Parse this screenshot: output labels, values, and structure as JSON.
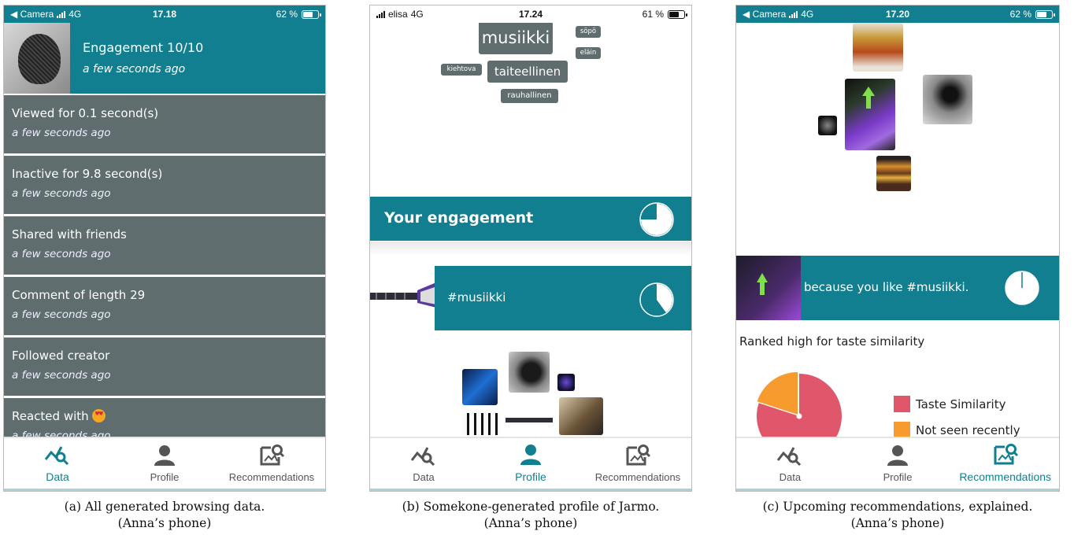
{
  "phones": [
    {
      "status": {
        "left": "◀ Camera",
        "network": "4G",
        "time": "17.18",
        "battery": "62 %"
      },
      "header": {
        "title": "Engagement 10/10",
        "time": "a few seconds ago"
      },
      "items": [
        {
          "title": "Viewed for 0.1 second(s)",
          "time": "a few seconds ago"
        },
        {
          "title": "Inactive for 9.8 second(s)",
          "time": "a few seconds ago"
        },
        {
          "title": "Shared with friends",
          "time": "a few seconds ago"
        },
        {
          "title": "Comment of length 29",
          "time": "a few seconds ago"
        },
        {
          "title": "Followed creator",
          "time": "a few seconds ago"
        },
        {
          "title": "Reacted with",
          "time": "a few seconds ago"
        }
      ],
      "nav": {
        "data": "Data",
        "profile": "Profile",
        "recs": "Recommendations",
        "active": "data"
      },
      "caption": {
        "line1": "(a) All generated browsing data.",
        "line2": "(Anna’s phone)"
      }
    },
    {
      "status": {
        "left": "elisa",
        "network": "4G",
        "time": "17.24",
        "battery": "61 %"
      },
      "tags": [
        "musiikki",
        "söpö",
        "eläin",
        "kiehtova",
        "taiteellinen",
        "rauhallinen"
      ],
      "engagement_title": "Your engagement",
      "engagement_fraction": 0.75,
      "hashtag": "#musiikki",
      "hashtag_fraction": 0.4,
      "nav": {
        "data": "Data",
        "profile": "Profile",
        "recs": "Recommendations",
        "active": "profile"
      },
      "caption": {
        "line1": "(b) Somekone-generated profile of Jarmo.",
        "line2": "(Anna’s phone)"
      }
    },
    {
      "status": {
        "left": "◀ Camera",
        "network": "4G",
        "time": "17.20",
        "battery": "62 %"
      },
      "reason": "because you like #musiikki.",
      "ranked": "Ranked high for taste similarity",
      "legend": [
        {
          "label": "Taste Similarity",
          "color": "#e0566a"
        },
        {
          "label": "Not seen recently",
          "color": "#f79b2e"
        }
      ],
      "pie": {
        "taste_similarity": 0.8,
        "not_seen_recently": 0.2
      },
      "nav": {
        "data": "Data",
        "profile": "Profile",
        "recs": "Recommendations",
        "active": "recs"
      },
      "caption": {
        "line1": "(c) Upcoming recommendations, explained.",
        "line2": "(Anna’s phone)"
      }
    }
  ],
  "colors": {
    "teal": "#117f8f",
    "slate": "#5f6d6f"
  }
}
